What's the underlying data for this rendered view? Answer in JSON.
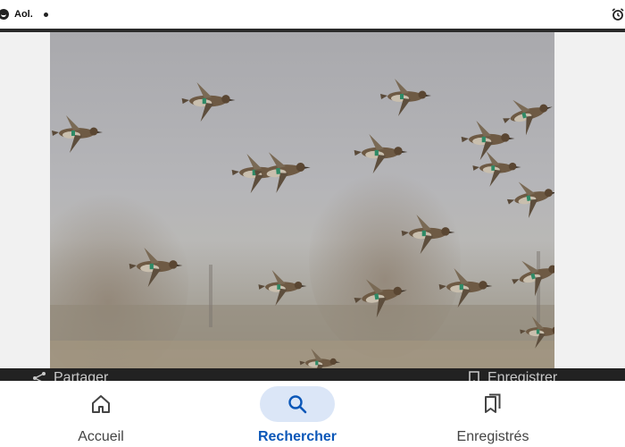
{
  "status_bar": {
    "app_label": "Aol.",
    "icons": [
      "app-badge-icon",
      "notification-dot-icon",
      "alarm-icon"
    ]
  },
  "image": {
    "subject_icon": "flying-ducks-photo"
  },
  "action_bar": {
    "share_label": "Partager",
    "save_label": "Enregistrer",
    "icons": [
      "share-icon",
      "bookmark-icon"
    ]
  },
  "bottom_nav": {
    "active": "Rechercher",
    "accent_color": "#0b57b8",
    "pill_color": "#dbe6f7",
    "items": [
      {
        "label": "Accueil",
        "icon": "home-icon"
      },
      {
        "label": "Rechercher",
        "icon": "search-icon"
      },
      {
        "label": "Enregistrés",
        "icon": "bookmarks-icon"
      }
    ]
  }
}
